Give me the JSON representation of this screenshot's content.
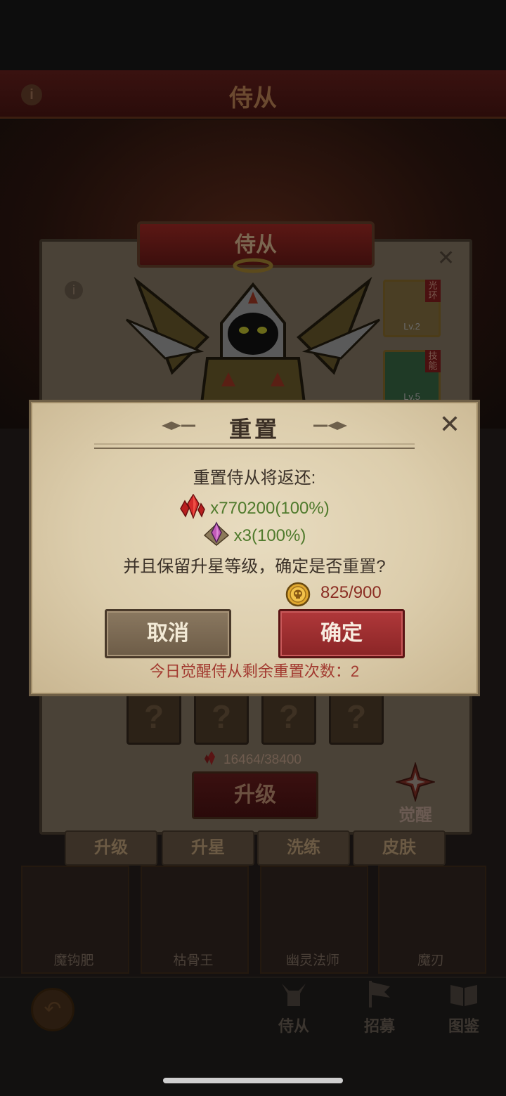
{
  "header": {
    "title": "侍从"
  },
  "card": {
    "banner_title": "侍从",
    "skills": [
      {
        "tag": "光环",
        "level": "Lv.2"
      },
      {
        "tag": "技能",
        "level": "Lv.5"
      }
    ],
    "upgrade_cost": "16464/38400",
    "upgrade_label": "升级",
    "awaken_label": "觉醒"
  },
  "tabs": [
    "升级",
    "升星",
    "洗练",
    "皮肤"
  ],
  "followers": [
    "魔钩肥",
    "枯骨王",
    "幽灵法师",
    "魔刃"
  ],
  "bottom_nav": [
    "侍从",
    "招募",
    "图鉴"
  ],
  "dialog": {
    "title": "重置",
    "intro": "重置侍从将返还:",
    "returns": [
      {
        "icon": "red-crystal-icon",
        "text": "x770200(100%)"
      },
      {
        "icon": "star-gem-icon",
        "text": "x3(100%)"
      }
    ],
    "keep_question": "并且保留升星等级，确定是否重置?",
    "coin_cost": "825/900",
    "cancel_label": "取消",
    "confirm_label": "确定",
    "remaining_text": "今日觉醒侍从剩余重置次数：2"
  },
  "colors": {
    "return_text": "#4f7a2c",
    "cost_text": "#8b2e24",
    "confirm_button": "#9e2e30",
    "cancel_button": "#7d6b54"
  }
}
